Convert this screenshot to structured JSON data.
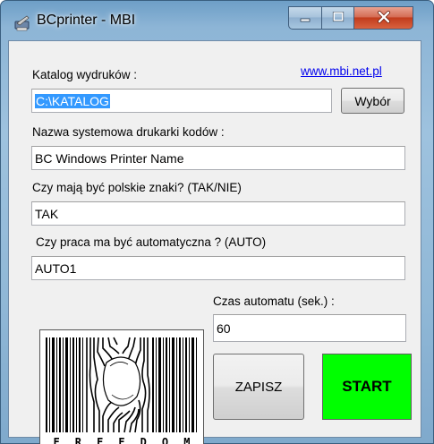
{
  "window": {
    "title": "BCprinter - MBI",
    "app_icon": "printer-feather-icon",
    "controls": {
      "minimize": "minimize-icon",
      "maximize": "maximize-icon",
      "close": "close-icon"
    }
  },
  "form": {
    "catalog_label": "Katalog wydruków :",
    "link": "www.mbi.net.pl",
    "catalog_value": "C:\\KATALOG",
    "browse_button": "Wybór",
    "printer_label": "Nazwa systemowa drukarki kodów :",
    "printer_value": "BC Windows Printer Name",
    "polish_label": "Czy mają być polskie znaki? (TAK/NIE)",
    "polish_value": "TAK",
    "auto_label": "Czy praca ma być automatyczna ? (AUTO)",
    "auto_value": "AUTO1",
    "timer_label": "Czas automatu (sek.) :",
    "timer_value": "60",
    "save_button": "ZAPISZ",
    "start_button": "START"
  },
  "barcode_image": {
    "icon": "freedom-barcode-image",
    "letters": [
      "F",
      "R",
      "E",
      "E",
      "D",
      "O",
      "M"
    ]
  },
  "colors": {
    "start_bg": "#00ff00",
    "selection": "#3399ff",
    "link": "#0000ee",
    "close_button": "#c7432a"
  }
}
